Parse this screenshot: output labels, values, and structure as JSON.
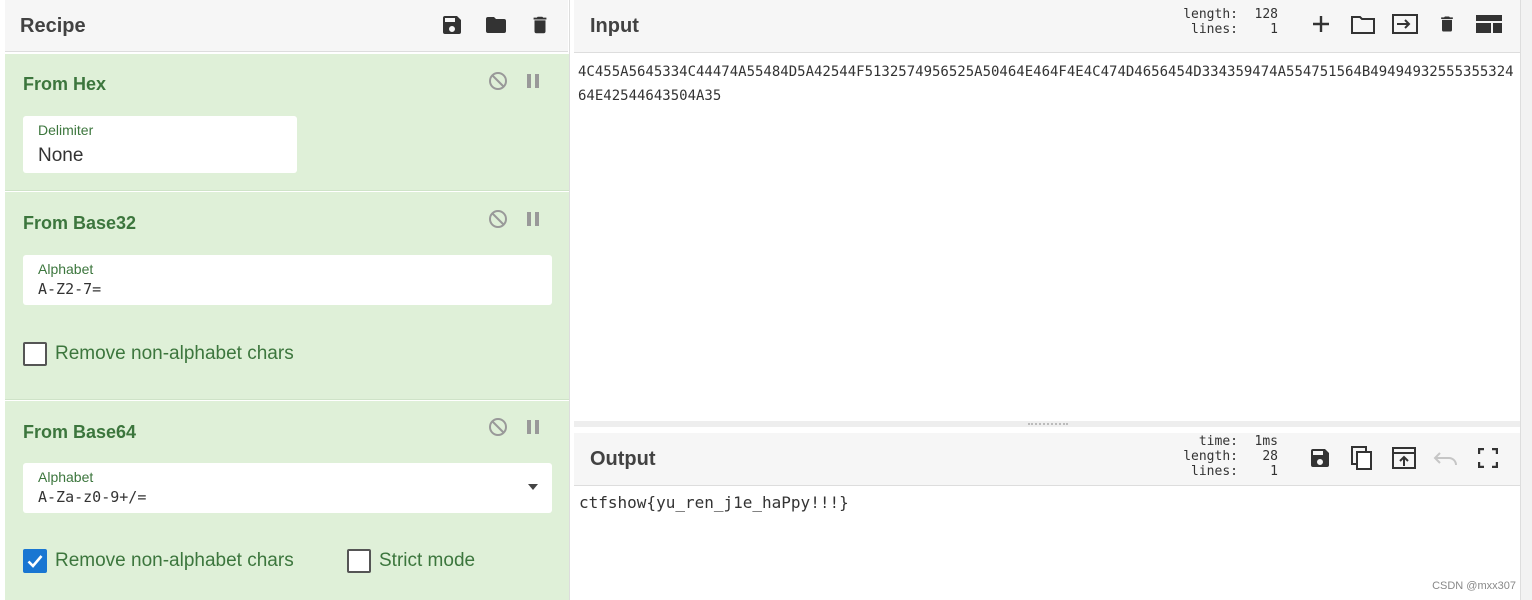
{
  "recipe": {
    "title": "Recipe",
    "icons": [
      "save-icon",
      "folder-icon",
      "trash-icon"
    ],
    "operations": [
      {
        "name": "From Hex",
        "field_label": "Delimiter",
        "field_value": "None"
      },
      {
        "name": "From Base32",
        "field_label": "Alphabet",
        "field_value": "A-Z2-7=",
        "checkbox_label": "Remove non-alphabet chars",
        "checkbox_checked": false
      },
      {
        "name": "From Base64",
        "field_label": "Alphabet",
        "field_value": "A-Za-z0-9+/=",
        "checkbox_label": "Remove non-alphabet chars",
        "checkbox_checked": true,
        "checkbox2_label": "Strict mode",
        "checkbox2_checked": false
      }
    ]
  },
  "input": {
    "title": "Input",
    "stats": [
      {
        "key": "length:",
        "value": "128"
      },
      {
        "key": "lines:",
        "value": "1"
      }
    ],
    "text": "4C455A5645334C44474A55484D5A42544F5132574956525A50464E464F4E4C474D4656454D334359474A554751564B4949493255535532464E42544643504A35"
  },
  "output": {
    "title": "Output",
    "stats": [
      {
        "key": "time:",
        "value": "1ms"
      },
      {
        "key": "length:",
        "value": "28"
      },
      {
        "key": "lines:",
        "value": "1"
      }
    ],
    "text": "ctfshow{yu_ren_j1e_haPpy!!!}"
  },
  "watermark": "CSDN @mxx307",
  "colors": {
    "op_background": "#dff0d8",
    "op_text": "#3c763d",
    "checkbox_checked": "#1976d2",
    "header_bg": "#f6f6f6"
  }
}
